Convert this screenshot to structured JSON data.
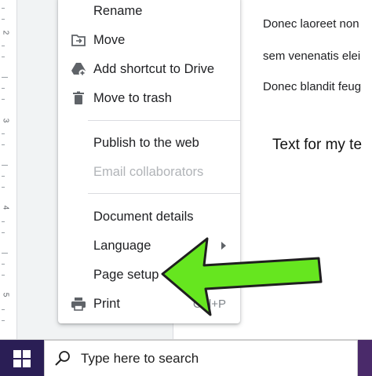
{
  "ruler": {
    "numbers": [
      "2",
      "3",
      "4",
      "5"
    ]
  },
  "document": {
    "lines": [
      "Donec laoreet non",
      "sem venenatis elei",
      "Donec blandit feug"
    ],
    "heading": "Text for my te"
  },
  "menu": {
    "items": [
      {
        "label": "Rename",
        "icon": "",
        "disabled": false
      },
      {
        "label": "Move",
        "icon": "move-to-folder-icon",
        "disabled": false
      },
      {
        "label": "Add shortcut to Drive",
        "icon": "drive-shortcut-icon",
        "disabled": false
      },
      {
        "label": "Move to trash",
        "icon": "trash-icon",
        "disabled": false
      },
      {
        "label": "Publish to the web",
        "icon": "",
        "disabled": false
      },
      {
        "label": "Email collaborators",
        "icon": "",
        "disabled": true
      },
      {
        "label": "Document details",
        "icon": "",
        "disabled": false
      },
      {
        "label": "Language",
        "icon": "",
        "disabled": false,
        "submenu": true
      },
      {
        "label": "Page setup",
        "icon": "",
        "disabled": false
      },
      {
        "label": "Print",
        "icon": "printer-icon",
        "disabled": false,
        "shortcut": "Ctrl+P"
      }
    ]
  },
  "annotation": {
    "color": "#66e61f",
    "icon": "green-arrow-pointer"
  },
  "taskbar": {
    "start_icon": "windows-logo-icon",
    "search_icon": "search-icon",
    "search_placeholder": "Type here to search"
  }
}
